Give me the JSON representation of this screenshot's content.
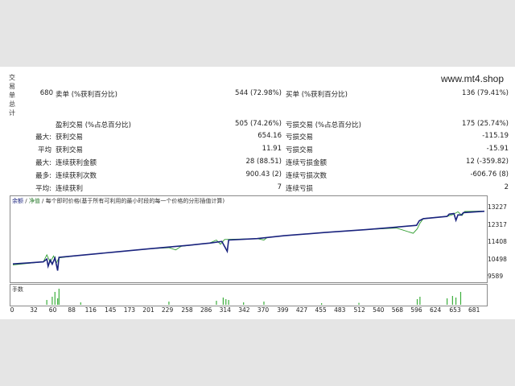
{
  "report": {
    "side_title": "交易单总计",
    "url": "www.mt4.shop",
    "total_trades": "680",
    "rows": [
      {
        "l1": "",
        "k1": "卖单 (%获利百分比)",
        "v1": "544 (72.98%)",
        "k2": "买单 (%获利百分比)",
        "v2": "136 (79.41%)"
      },
      {
        "l1": "",
        "k1": "盈利交易 (%占总百分比)",
        "v1": "505 (74.26%)",
        "k2": "亏损交易 (%占总百分比)",
        "v2": "175 (25.74%)"
      },
      {
        "l1": "最大:",
        "k1": "获利交易",
        "v1": "654.16",
        "k2": "亏损交易",
        "v2": "-115.19"
      },
      {
        "l1": "平均",
        "k1": "获利交易",
        "v1": "11.91",
        "k2": "亏损交易",
        "v2": "-15.91"
      },
      {
        "l1": "最大:",
        "k1": "连续获利金额",
        "v1": "28 (88.51)",
        "k2": "连续亏损金额",
        "v2": "12 (-359.82)"
      },
      {
        "l1": "最多:",
        "k1": "连续获利次数",
        "v1": "900.43 (2)",
        "k2": "连续亏损次数",
        "v2": "-606.76 (8)"
      },
      {
        "l1": "平均:",
        "k1": "连续获利",
        "v1": "7",
        "k2": "连续亏损",
        "v2": "2"
      }
    ]
  },
  "chart": {
    "legend_balance": "余额",
    "legend_sep": " / ",
    "legend_equity": "净值",
    "legend_note": " / 每个即时价格(基于所有可利用的最小时段的每一个价格的分形插值计算)",
    "volume_label": "手数",
    "colors": {
      "balance": "#1a237e",
      "equity": "#2e9e2e",
      "volume": "#3cae3c"
    }
  },
  "chart_data": {
    "type": "line",
    "yticks": [
      13227,
      12317,
      11408,
      10498,
      9589
    ],
    "xticks": [
      0,
      32,
      60,
      88,
      116,
      145,
      173,
      201,
      229,
      258,
      286,
      314,
      342,
      370,
      399,
      427,
      455,
      483,
      512,
      540,
      568,
      596,
      624,
      653,
      681
    ],
    "xlim": [
      0,
      695
    ],
    "ylim": [
      9589,
      13450
    ],
    "series": [
      {
        "name": "余额",
        "points": [
          [
            0,
            10300
          ],
          [
            25,
            10360
          ],
          [
            45,
            10410
          ],
          [
            50,
            10560
          ],
          [
            52,
            10180
          ],
          [
            55,
            10500
          ],
          [
            58,
            10290
          ],
          [
            62,
            10620
          ],
          [
            66,
            9950
          ],
          [
            68,
            10650
          ],
          [
            100,
            10760
          ],
          [
            150,
            10930
          ],
          [
            200,
            11100
          ],
          [
            260,
            11290
          ],
          [
            290,
            11400
          ],
          [
            308,
            11490
          ],
          [
            316,
            10970
          ],
          [
            318,
            11560
          ],
          [
            360,
            11640
          ],
          [
            400,
            11790
          ],
          [
            460,
            11960
          ],
          [
            520,
            12110
          ],
          [
            560,
            12230
          ],
          [
            595,
            12340
          ],
          [
            599,
            12580
          ],
          [
            605,
            12690
          ],
          [
            640,
            12810
          ],
          [
            643,
            12930
          ],
          [
            650,
            12960
          ],
          [
            653,
            12600
          ],
          [
            656,
            12890
          ],
          [
            661,
            12880
          ],
          [
            664,
            13010
          ],
          [
            695,
            13080
          ]
        ]
      },
      {
        "name": "净值",
        "points": [
          [
            0,
            10250
          ],
          [
            45,
            10410
          ],
          [
            50,
            10780
          ],
          [
            55,
            10400
          ],
          [
            60,
            10720
          ],
          [
            64,
            10350
          ],
          [
            68,
            10620
          ],
          [
            100,
            10760
          ],
          [
            150,
            10930
          ],
          [
            200,
            11100
          ],
          [
            230,
            11160
          ],
          [
            240,
            11040
          ],
          [
            248,
            11230
          ],
          [
            290,
            11400
          ],
          [
            300,
            11560
          ],
          [
            306,
            11340
          ],
          [
            312,
            11590
          ],
          [
            360,
            11640
          ],
          [
            370,
            11560
          ],
          [
            375,
            11700
          ],
          [
            400,
            11790
          ],
          [
            460,
            11960
          ],
          [
            520,
            12110
          ],
          [
            565,
            12200
          ],
          [
            590,
            11920
          ],
          [
            596,
            12150
          ],
          [
            600,
            12450
          ],
          [
            605,
            12700
          ],
          [
            640,
            12810
          ],
          [
            648,
            12900
          ],
          [
            656,
            13050
          ],
          [
            662,
            12860
          ],
          [
            666,
            13070
          ],
          [
            695,
            13090
          ]
        ]
      }
    ],
    "volume": [
      [
        50,
        0.3
      ],
      [
        58,
        0.5
      ],
      [
        62,
        0.8
      ],
      [
        66,
        0.4
      ],
      [
        68,
        1.0
      ],
      [
        100,
        0.15
      ],
      [
        230,
        0.2
      ],
      [
        300,
        0.25
      ],
      [
        310,
        0.45
      ],
      [
        314,
        0.35
      ],
      [
        318,
        0.3
      ],
      [
        340,
        0.15
      ],
      [
        370,
        0.2
      ],
      [
        455,
        0.1
      ],
      [
        510,
        0.12
      ],
      [
        596,
        0.35
      ],
      [
        600,
        0.5
      ],
      [
        640,
        0.4
      ],
      [
        648,
        0.55
      ],
      [
        653,
        0.45
      ],
      [
        660,
        0.8
      ]
    ]
  }
}
